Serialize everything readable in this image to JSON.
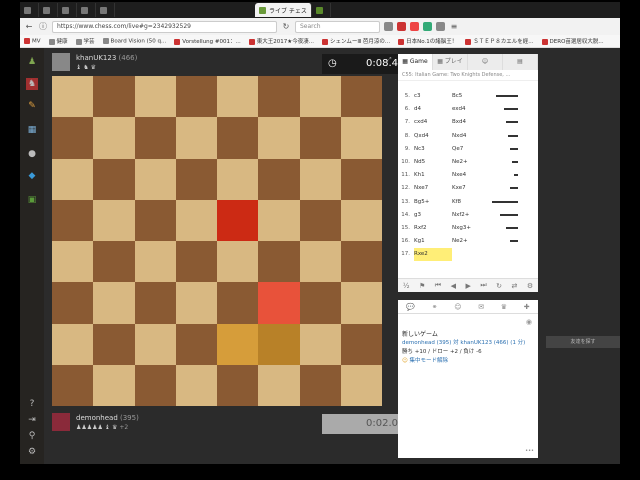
{
  "browser": {
    "tabs": [
      {
        "label": ""
      },
      {
        "label": ""
      },
      {
        "label": ""
      },
      {
        "label": ""
      },
      {
        "label": ""
      },
      {
        "label": "ライブ チェス",
        "active": true
      },
      {
        "label": ""
      }
    ],
    "url": "https://www.chess.com/live#g=2342932529",
    "search_placeholder": "Search",
    "bookmarks": [
      "MV",
      "健康",
      "学芸",
      "Board Vision (50 q...",
      "Vorstellung #001：...",
      "東大王2017★今夜凄...",
      "シェンムーⅢ 芭月涼の...",
      "日本No.1の諸脳王！",
      "ＳＴＥＰ８カエルを経...",
      "DERO苗選居収大脱..."
    ]
  },
  "sidebar": {
    "icons": [
      "home-icon",
      "play-icon",
      "puzzle-icon",
      "lessons-icon",
      "chat-icon",
      "diamond-icon",
      "more-icon"
    ],
    "bottom_icons": [
      "help-icon",
      "logout-icon",
      "search-icon",
      "settings-icon"
    ],
    "badge": "14"
  },
  "top_player": {
    "name": "khanUK123",
    "rating": "(466)",
    "captured": "♝ ♞ ♛",
    "clock": "0:08.4"
  },
  "bottom_player": {
    "name": "demonhead",
    "rating": "(395)",
    "captured": "♟♟♟♟♟ ♝ ♛",
    "diff": "+2",
    "clock": "0:02.0"
  },
  "panel": {
    "tabs": [
      "Game",
      "プレイ",
      "",
      ""
    ],
    "opening": "C55: Italian Game: Two Knights Defense, ...",
    "moves": [
      {
        "n": "5.",
        "w": "c3",
        "b": "Bc5",
        "bar": 22
      },
      {
        "n": "6.",
        "w": "d4",
        "b": "exd4",
        "bar": 14
      },
      {
        "n": "7.",
        "w": "cxd4",
        "b": "Bxd4",
        "bar": 12
      },
      {
        "n": "8.",
        "w": "Qxd4",
        "b": "Nxd4",
        "bar": 10
      },
      {
        "n": "9.",
        "w": "Nc3",
        "b": "Qe7",
        "bar": 8
      },
      {
        "n": "10.",
        "w": "Nd5",
        "b": "Ne2+",
        "bar": 6
      },
      {
        "n": "11.",
        "w": "Kh1",
        "b": "Nxe4",
        "bar": 4
      },
      {
        "n": "12.",
        "w": "Nxe7",
        "b": "Kxe7",
        "bar": 8
      },
      {
        "n": "13.",
        "w": "Bg5+",
        "b": "Kf8",
        "bar": 26
      },
      {
        "n": "14.",
        "w": "g3",
        "b": "Nxf2+",
        "bar": 18
      },
      {
        "n": "15.",
        "w": "Rxf2",
        "b": "Nxg3+",
        "bar": 12
      },
      {
        "n": "16.",
        "w": "Kg1",
        "b": "Ne2+",
        "bar": 8
      },
      {
        "n": "17.",
        "w": "Rxe2",
        "b": "",
        "bar": 0
      }
    ],
    "controls": [
      "½",
      "⚑",
      "⏮",
      "◀",
      "▶",
      "⏭",
      "↻",
      "⇄",
      "⚙"
    ]
  },
  "chat": {
    "title": "新しいゲーム",
    "line1": "demonhead (395) 対 khanUK123 (466) (1 分)",
    "line2": "勝ち +10 / ドロー +2 / 負け -6",
    "focus": "集中モード解除"
  },
  "right_button": "友達を探す"
}
